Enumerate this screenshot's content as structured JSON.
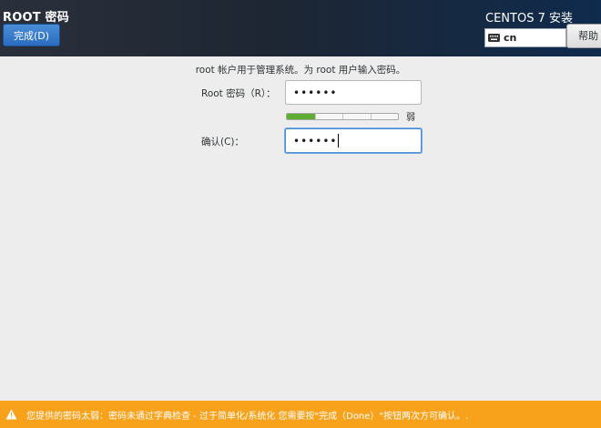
{
  "header": {
    "title": "ROOT 密码",
    "done_button": "完成(D)",
    "install_title": "CENTOS 7 安装",
    "keyboard_layout": "cn",
    "help_button": "帮助"
  },
  "form": {
    "instruction": "root 帐户用于管理系统。为 root 用户输入密码。",
    "password_label": "Root 密码（R）：",
    "password_value": "••••••",
    "strength_label": "弱",
    "strength_level": 0.25,
    "confirm_label": "确认(C)：",
    "confirm_value": "••••••"
  },
  "warning": {
    "text": "您提供的密码太弱：密码未通过字典检查 - 过于简单化/系统化 您需要按\"完成（Done）\"按钮两次方可确认。."
  },
  "colors": {
    "warning_bar": "#f7a21a",
    "strength_fill": "#5fae31",
    "focus_border": "#4a90d9"
  }
}
